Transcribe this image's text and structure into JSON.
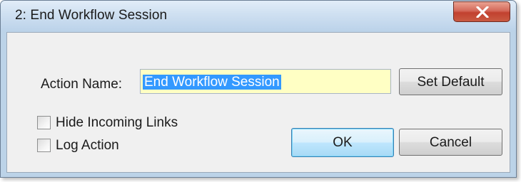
{
  "window": {
    "title": "2: End Workflow Session",
    "close_glyph": "x"
  },
  "form": {
    "action_name_label": "Action Name:",
    "action_name_value": "End Workflow Session",
    "set_default_label": "Set Default",
    "hide_incoming_links_label": "Hide Incoming Links",
    "hide_incoming_links_checked": false,
    "log_action_label": "Log Action",
    "log_action_checked": false,
    "ok_label": "OK",
    "cancel_label": "Cancel"
  },
  "colors": {
    "input_background": "#ffffc4",
    "selection_highlight": "#3399ff",
    "close_button": "#c9452f"
  },
  "icons": {
    "close": "close-icon"
  }
}
